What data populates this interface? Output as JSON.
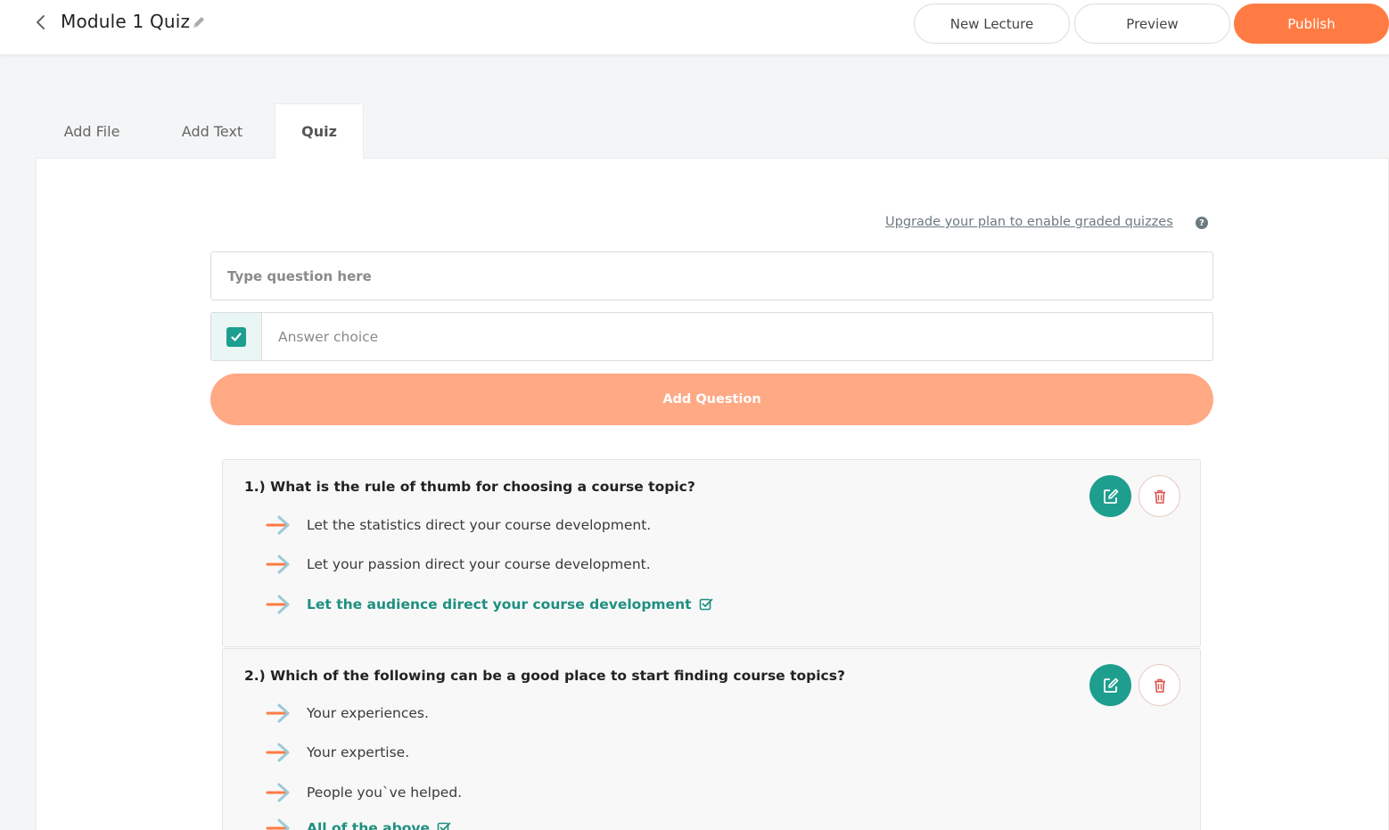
{
  "header": {
    "title": "Module 1 Quiz",
    "new_lecture_label": "New Lecture",
    "preview_label": "Preview",
    "publish_label": "Publish"
  },
  "tabs": [
    {
      "label": "Add File",
      "active": false
    },
    {
      "label": "Add Text",
      "active": false
    },
    {
      "label": "Quiz",
      "active": true
    }
  ],
  "editor": {
    "upgrade_link": "Upgrade your plan to enable graded quizzes",
    "help_icon": "?",
    "question_placeholder": "Type question here",
    "answer_placeholder": "Answer choice",
    "answer_checked": true,
    "add_question_label": "Add Question"
  },
  "questions": [
    {
      "title": "1.) What is the rule of thumb for choosing a course topic?",
      "options": [
        {
          "text": "Let the statistics direct your course development.",
          "correct": false
        },
        {
          "text": "Let your passion direct your course development.",
          "correct": false
        },
        {
          "text": "Let the audience direct your course development",
          "correct": true
        }
      ]
    },
    {
      "title": "2.) Which of the following can be a good place to start finding course topics?",
      "options": [
        {
          "text": "Your experiences.",
          "correct": false
        },
        {
          "text": "Your expertise.",
          "correct": false
        },
        {
          "text": "People you`ve helped.",
          "correct": false
        },
        {
          "text": "All of the above",
          "correct": true
        }
      ]
    }
  ],
  "icons": {
    "back": "chevron-left-icon",
    "edit_title": "pencil-icon",
    "option": "arrow-right-icon",
    "correct": "check-square-icon",
    "edit": "edit-icon",
    "delete": "trash-icon"
  },
  "colors": {
    "accent_orange": "#ff7b43",
    "accent_orange_light": "#ffa985",
    "teal": "#1e9e8f",
    "correct_text": "#1e8f80"
  }
}
